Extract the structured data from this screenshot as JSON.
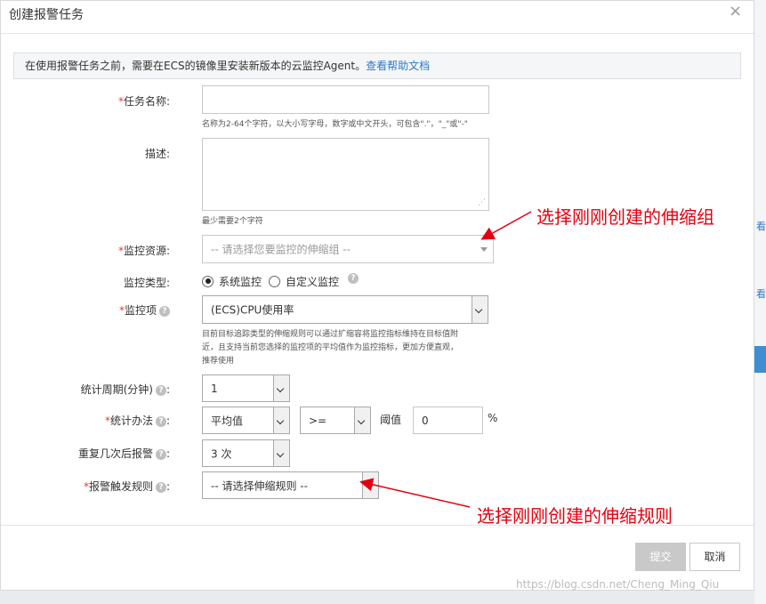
{
  "dialog": {
    "title": "创建报警任务",
    "close_glyph": "×"
  },
  "notice": {
    "text": "在使用报警任务之前，需要在ECS的镜像里安装新版本的云监控Agent。",
    "link": "查看帮助文档"
  },
  "form": {
    "task_name": {
      "label": "任务名称:",
      "value": "",
      "hint": "名称为2-64个字符，以大小写字母，数字或中文开头，可包含\".\"，\"_\"或\"-\""
    },
    "description": {
      "label": "描述:",
      "value": "",
      "hint": "最少需要2个字符"
    },
    "resource": {
      "label": "监控资源:",
      "placeholder": "-- 请选择您要监控的伸缩组 --"
    },
    "monitor_type": {
      "label": "监控类型:",
      "options": [
        "系统监控",
        "自定义监控"
      ],
      "selected": "系统监控"
    },
    "metric": {
      "label": "监控项",
      "value": "(ECS)CPU使用率",
      "hint_lines": [
        "目前目标追踪类型的伸缩规则可以通过扩缩容将监控指标维持在目标值附",
        "近，且支持当前您选择的监控项的平均值作为监控指标，更加方便直观，",
        "推荐使用"
      ]
    },
    "period": {
      "label": "统计周期(分钟)",
      "value": "1"
    },
    "method": {
      "label": "统计办法",
      "agg": "平均值",
      "operator": ">=",
      "threshold_label": "阈值",
      "threshold_value": "0",
      "unit": "%"
    },
    "repeat": {
      "label": "重复几次后报警",
      "value": "3 次"
    },
    "rule": {
      "label": "报警触发规则",
      "placeholder": "-- 请选择伸缩规则 --"
    },
    "required_mark": "*"
  },
  "buttons": {
    "submit": "提交",
    "cancel": "取消"
  },
  "annotations": {
    "top": "选择刚刚创建的伸缩组",
    "bottom": "选择刚刚创建的伸缩规则"
  },
  "watermark": "https://blog.csdn.net/Cheng_Ming_Qiu",
  "backdrop": {
    "link_glyph": "看"
  },
  "colors": {
    "accent": "#2b7acb",
    "required": "#e4393c",
    "annotation": "#e4000f"
  }
}
